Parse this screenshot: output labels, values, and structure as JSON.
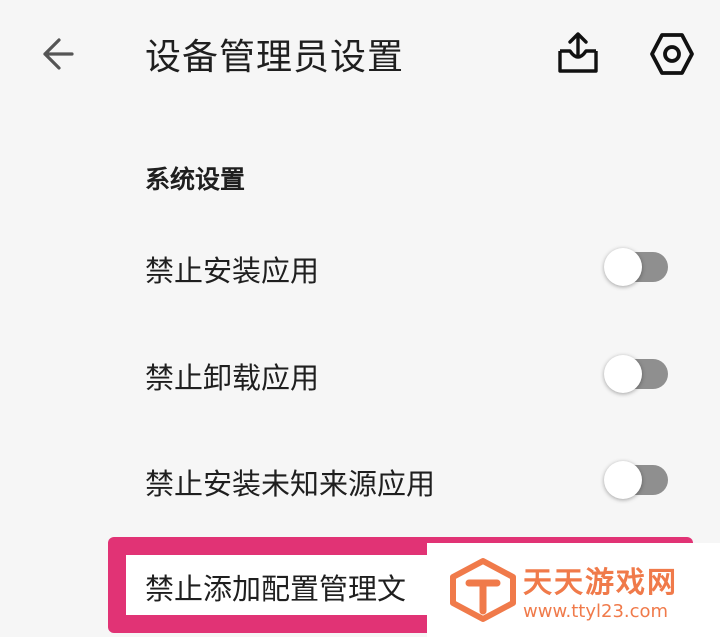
{
  "header": {
    "title": "设备管理员设置",
    "back_icon": "arrow-left-icon",
    "export_icon": "export-icon",
    "settings_icon": "gear-icon"
  },
  "section": {
    "title": "系统设置"
  },
  "settings": [
    {
      "label": "禁止安装应用",
      "enabled": false
    },
    {
      "label": "禁止卸载应用",
      "enabled": false
    },
    {
      "label": "禁止安装未知来源应用",
      "enabled": false
    },
    {
      "label": "禁止添加配置管理文",
      "enabled": false
    }
  ],
  "watermark": {
    "name": "天天游戏网",
    "url": "www.ttyl23.com"
  },
  "colors": {
    "highlight": "#e13375",
    "background": "#f6f6f6",
    "toggle_track_off": "#8f8f8f",
    "watermark": "#f07a4a"
  }
}
